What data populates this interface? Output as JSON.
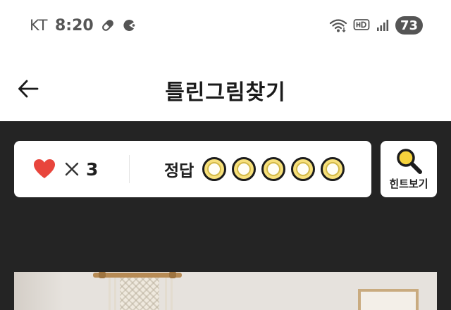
{
  "status_bar": {
    "carrier": "KT",
    "time": "8:20",
    "battery": "73",
    "icons": [
      "pill-icon",
      "pacman-icon",
      "wifi-icon",
      "hd-icon",
      "signal-icon",
      "battery-icon"
    ]
  },
  "header": {
    "title": "틀린그림찾기",
    "back_icon": "arrow-left-icon"
  },
  "game": {
    "lives": {
      "icon": "heart-icon",
      "separator": "×",
      "count": "3"
    },
    "answers": {
      "label": "정답",
      "found": 0,
      "total": 5
    },
    "hint": {
      "label": "힌트보기",
      "icon": "magnifier-icon"
    }
  },
  "colors": {
    "game_background": "#242424",
    "heart": "#e8453c",
    "answer_fill": "#f7e07a",
    "hint_accent": "#f5d23c",
    "status_text": "#555555"
  }
}
